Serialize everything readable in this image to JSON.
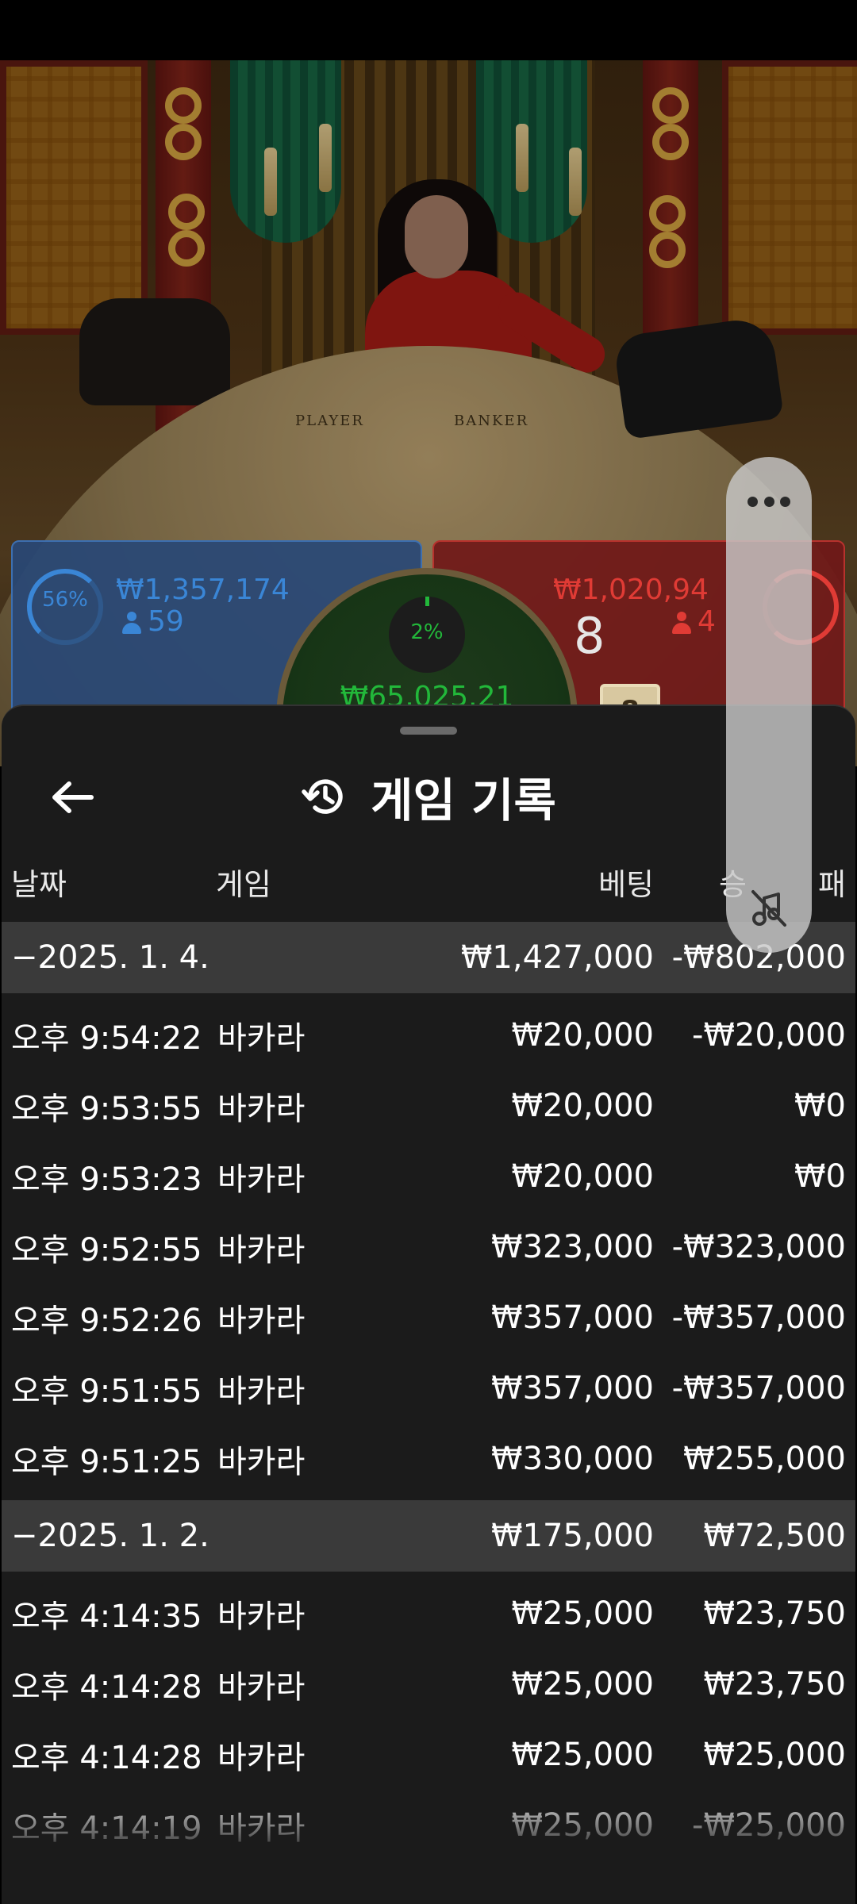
{
  "video": {
    "table_labels": {
      "player": "PLAYER",
      "banker": "BANKER"
    }
  },
  "bets": {
    "player": {
      "percent": "56%",
      "amount": "₩1,357,174",
      "count": "59",
      "color": "#3a86d6"
    },
    "tie": {
      "percent": "2%",
      "amount": "₩65,025.21",
      "color": "#22b83a"
    },
    "banker": {
      "amount": "₩1,020,94",
      "score": "8",
      "count": "4",
      "card": "8",
      "color": "#e03b35"
    }
  },
  "sheet": {
    "title": "게임 기록",
    "back_icon": "arrow-left-icon",
    "title_icon": "history-icon",
    "columns": {
      "date": "날짜",
      "game": "게임",
      "bet": "베팅",
      "result_partial": "승",
      "result_tail": "패"
    },
    "groups": [
      {
        "date": "−2025. 1. 4.",
        "bet": "₩1,427,000",
        "result": "-₩802,000",
        "rows": [
          {
            "time": "오후 9:54:22",
            "game": "바카라",
            "bet": "₩20,000",
            "result": "-₩20,000"
          },
          {
            "time": "오후 9:53:55",
            "game": "바카라",
            "bet": "₩20,000",
            "result": "₩0"
          },
          {
            "time": "오후 9:53:23",
            "game": "바카라",
            "bet": "₩20,000",
            "result": "₩0"
          },
          {
            "time": "오후 9:52:55",
            "game": "바카라",
            "bet": "₩323,000",
            "result": "-₩323,000"
          },
          {
            "time": "오후 9:52:26",
            "game": "바카라",
            "bet": "₩357,000",
            "result": "-₩357,000"
          },
          {
            "time": "오후 9:51:55",
            "game": "바카라",
            "bet": "₩357,000",
            "result": "-₩357,000"
          },
          {
            "time": "오후 9:51:25",
            "game": "바카라",
            "bet": "₩330,000",
            "result": "₩255,000"
          }
        ]
      },
      {
        "date": "−2025. 1. 2.",
        "bet": "₩175,000",
        "result": "₩72,500",
        "rows": [
          {
            "time": "오후 4:14:35",
            "game": "바카라",
            "bet": "₩25,000",
            "result": "₩23,750"
          },
          {
            "time": "오후 4:14:28",
            "game": "바카라",
            "bet": "₩25,000",
            "result": "₩23,750"
          },
          {
            "time": "오후 4:14:28",
            "game": "바카라",
            "bet": "₩25,000",
            "result": "₩25,000"
          },
          {
            "time": "오후 4:14:19",
            "game": "바카라",
            "bet": "₩25,000",
            "result": "-₩25,000"
          }
        ]
      }
    ]
  },
  "side_control": {
    "menu_icon": "more-dots-icon",
    "sound_icon": "music-off-icon"
  }
}
